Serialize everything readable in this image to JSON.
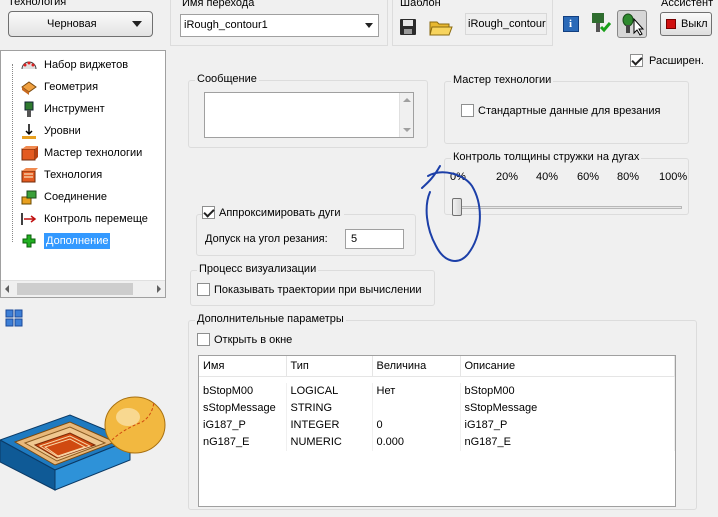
{
  "header": {
    "tech_label": "Технология",
    "tech_value": "Черновая",
    "transition_label": "Имя перехода",
    "transition_value": "iRough_contour1",
    "template_label": "Шаблон",
    "template_value": "iRough_contour",
    "assistant_label": "Ассистент",
    "assistant_button": "Выкл"
  },
  "tree": {
    "items": [
      {
        "label": "Набор виджетов",
        "icon": "widget-set-icon"
      },
      {
        "label": "Геометрия",
        "icon": "geometry-icon"
      },
      {
        "label": "Инструмент",
        "icon": "tool-icon"
      },
      {
        "label": "Уровни",
        "icon": "levels-icon"
      },
      {
        "label": "Мастер технологии",
        "icon": "tech-master-icon"
      },
      {
        "label": "Технология",
        "icon": "technology-icon"
      },
      {
        "label": "Соединение",
        "icon": "connection-icon"
      },
      {
        "label": "Контроль перемеще",
        "icon": "move-control-icon"
      },
      {
        "label": "Дополнение",
        "icon": "addition-icon"
      }
    ]
  },
  "extended": {
    "label": "Расширен.",
    "checked": true
  },
  "message": {
    "label": "Сообщение",
    "value": ""
  },
  "tech_master": {
    "label": "Мастер технологии",
    "checkbox_label": "Стандартные данные для врезания",
    "checked": false
  },
  "chip_control": {
    "label": "Контроль толщины стружки на дугах",
    "ticks": [
      "0%",
      "20%",
      "40%",
      "60%",
      "80%",
      "100%"
    ],
    "value_percent": 0
  },
  "arcs": {
    "checkbox_label": "Аппроксимировать дуги",
    "checked": true,
    "tolerance_label": "Допуск на угол резания:",
    "tolerance_value": "5"
  },
  "visualization": {
    "label": "Процесс визуализации",
    "checkbox_label": "Показывать траектории при вычислении",
    "checked": false
  },
  "extra_params": {
    "label": "Дополнительные параметры",
    "open_label": "Открыть в окне",
    "open_checked": false,
    "columns": [
      "Имя",
      "Тип",
      "Величина",
      "Описание"
    ],
    "rows": [
      [
        "bStopM00",
        "LOGICAL",
        "Нет",
        "bStopM00"
      ],
      [
        "sStopMessage",
        "STRING",
        "",
        "sStopMessage"
      ],
      [
        "iG187_P",
        "INTEGER",
        "0",
        "iG187_P"
      ],
      [
        "nG187_E",
        "NUMERIC",
        "0.000",
        "nG187_E"
      ]
    ]
  },
  "colors": {
    "selected": "#3399ff",
    "annotation": "#1c3fa8",
    "accent_orange": "#e59a2a"
  }
}
